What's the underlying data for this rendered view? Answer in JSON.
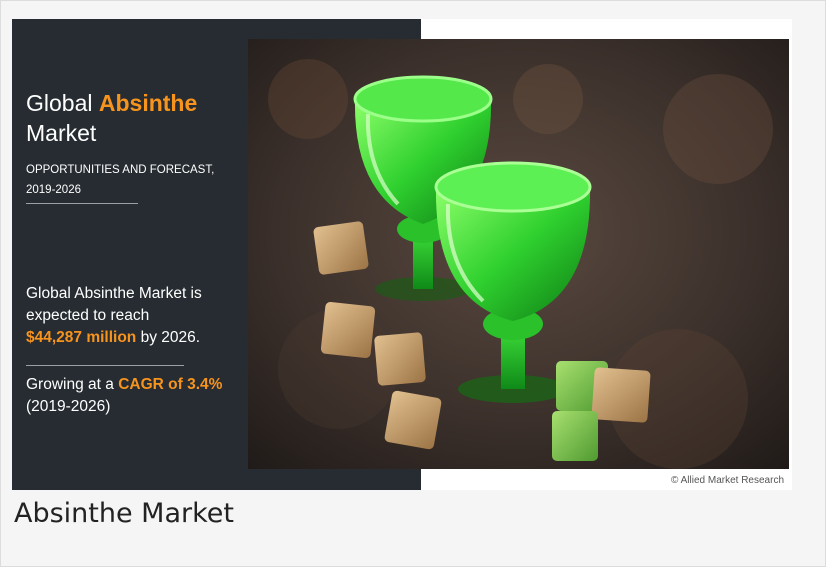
{
  "infographic": {
    "title_prefix": "Global",
    "title_accent": "Absinthe",
    "title_line2": "Market",
    "subtitle_line1": "OPPORTUNITIES AND FORECAST,",
    "subtitle_line2": "2019-2026",
    "stat_line1": "Global Absinthe Market is",
    "stat_line2": "expected to reach",
    "stat_value": "$44,287 million",
    "stat_suffix": "by 2026.",
    "growth_prefix": "Growing at a",
    "growth_value": "CAGR of 3.4%",
    "growth_period": "(2019-2026)",
    "copyright": "© Allied Market Research",
    "colors": {
      "panel": "#262c31",
      "accent": "#f7941d",
      "liquid": "#38d23a"
    }
  },
  "caption": "Absinthe Market"
}
